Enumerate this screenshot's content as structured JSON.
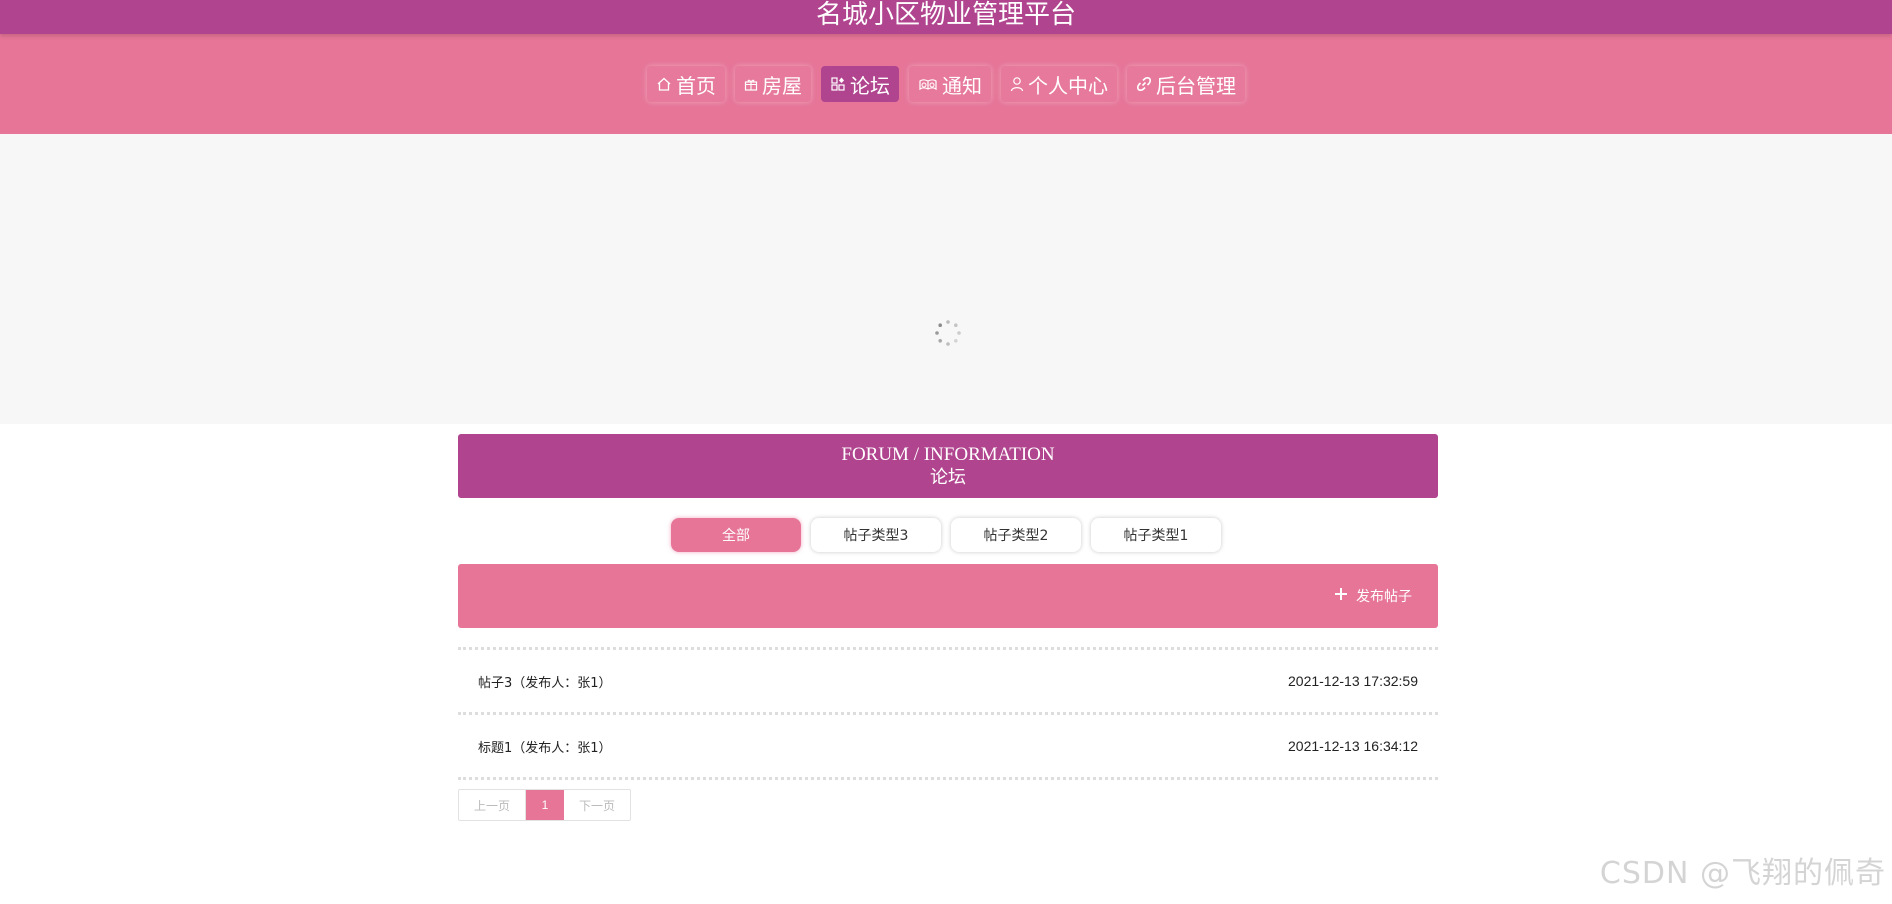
{
  "app": {
    "title": "名城小区物业管理平台"
  },
  "nav": {
    "items": [
      {
        "label": "首页",
        "icon": "home-icon"
      },
      {
        "label": "房屋",
        "icon": "gift-icon"
      },
      {
        "label": "论坛",
        "icon": "apps-icon",
        "active": true
      },
      {
        "label": "通知",
        "icon": "read-icon"
      },
      {
        "label": "个人中心",
        "icon": "user-icon"
      },
      {
        "label": "后台管理",
        "icon": "link-icon"
      }
    ]
  },
  "forum": {
    "title_en": "FORUM / INFORMATION",
    "title_cn": "论坛"
  },
  "categories": [
    {
      "label": "全部",
      "active": true
    },
    {
      "label": "帖子类型3"
    },
    {
      "label": "帖子类型2"
    },
    {
      "label": "帖子类型1"
    }
  ],
  "publish": {
    "label": "发布帖子"
  },
  "posts": [
    {
      "title": "帖子3（发布人：张1）",
      "time": "2021-12-13 17:32:59"
    },
    {
      "title": "标题1（发布人：张1）",
      "time": "2021-12-13 16:34:12"
    }
  ],
  "pagination": {
    "prev": "上一页",
    "current": "1",
    "next": "下一页"
  },
  "watermark": "CSDN @飞翔的佩奇",
  "colors": {
    "primary": "#b0448e",
    "accent": "#e67598",
    "banner_bg": "#f7f7f7"
  }
}
